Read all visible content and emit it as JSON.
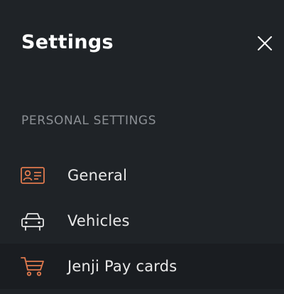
{
  "header": {
    "title": "Settings",
    "close_icon": "close-icon"
  },
  "section": {
    "label": "PERSONAL SETTINGS"
  },
  "menu": [
    {
      "label": "General",
      "icon": "id-card-icon",
      "icon_color": "#e07a4e"
    },
    {
      "label": "Vehicles",
      "icon": "car-icon",
      "icon_color": "#e6e6e6"
    },
    {
      "label": "Jenji Pay cards",
      "icon": "shopping-cart-icon",
      "icon_color": "#e07a4e",
      "active": true
    }
  ],
  "colors": {
    "background": "#1f2327",
    "active_row": "#1a1d21",
    "accent": "#e07a4e",
    "section_label": "#8c9095"
  }
}
